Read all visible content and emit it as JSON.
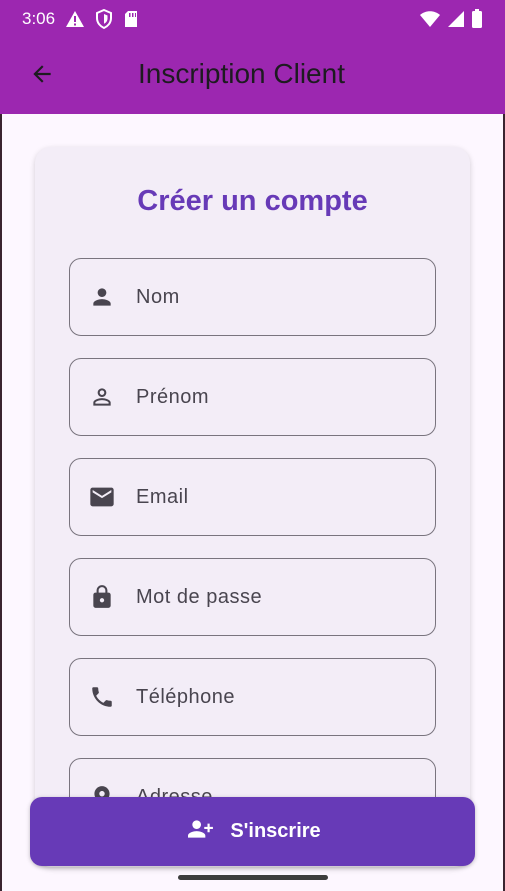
{
  "status_bar": {
    "time": "3:06",
    "left_icons": [
      "warning-icon",
      "shield-icon",
      "sd-card-icon"
    ],
    "right_icons": [
      "wifi-icon",
      "signal-icon",
      "battery-icon"
    ],
    "color": "#9c27b0"
  },
  "app_bar": {
    "title": "Inscription Client",
    "back_icon": "arrow-back-icon",
    "color": "#9c27b0"
  },
  "form": {
    "title": "Créer un compte",
    "fields": [
      {
        "label": "Nom",
        "icon": "person-icon"
      },
      {
        "label": "Prénom",
        "icon": "person-outline-icon"
      },
      {
        "label": "Email",
        "icon": "email-icon"
      },
      {
        "label": "Mot de passe",
        "icon": "lock-icon"
      },
      {
        "label": "Téléphone",
        "icon": "phone-icon"
      },
      {
        "label": "Adresse",
        "icon": "location-pin-icon"
      }
    ]
  },
  "submit": {
    "label": "S'inscrire",
    "icon": "person-add-icon",
    "color": "#673ab7"
  },
  "colors": {
    "accent": "#673ab7",
    "background": "#fdf7ff",
    "card": "#f3edf7",
    "outline": "#79747e"
  }
}
